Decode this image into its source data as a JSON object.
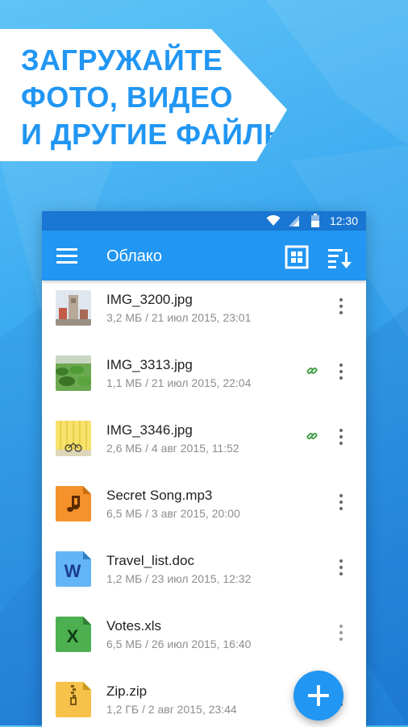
{
  "banner": {
    "line1": "ЗАГРУЖАЙТЕ",
    "line2": "ФОТО, ВИДЕО",
    "line3": "И ДРУГИЕ ФАЙЛЫ",
    "color": "#2196f3"
  },
  "statusbar": {
    "time": "12:30",
    "icons": [
      "wifi-icon",
      "signal-icon",
      "battery-icon"
    ]
  },
  "appbar": {
    "title": "Облако",
    "color": "#2196f3",
    "icons": [
      "menu-icon",
      "grid-view-icon",
      "sort-icon"
    ]
  },
  "files": [
    {
      "name": "IMG_3200.jpg",
      "meta": "3,2 МБ / 21 июл 2015, 23:01",
      "type": "image",
      "shared": false
    },
    {
      "name": "IMG_3313.jpg",
      "meta": "1,1 МБ / 21 июл 2015, 22:04",
      "type": "image",
      "shared": true
    },
    {
      "name": "IMG_3346.jpg",
      "meta": "2,6 МБ / 4 авг 2015, 11:52",
      "type": "image",
      "shared": true
    },
    {
      "name": "Secret Song.mp3",
      "meta": "6,5 МБ / 3 авг 2015, 20:00",
      "type": "audio",
      "shared": false
    },
    {
      "name": "Travel_list.doc",
      "meta": "1,2 МБ / 23 июл 2015, 12:32",
      "type": "doc",
      "shared": false
    },
    {
      "name": "Votes.xls",
      "meta": "6,5 МБ / 26 июл 2015, 16:40",
      "type": "xls",
      "shared": false
    },
    {
      "name": "Zip.zip",
      "meta": "1,2 ГБ / 2 авг 2015, 23:44",
      "type": "zip",
      "shared": false
    }
  ],
  "fab": {
    "icon": "plus-icon"
  }
}
